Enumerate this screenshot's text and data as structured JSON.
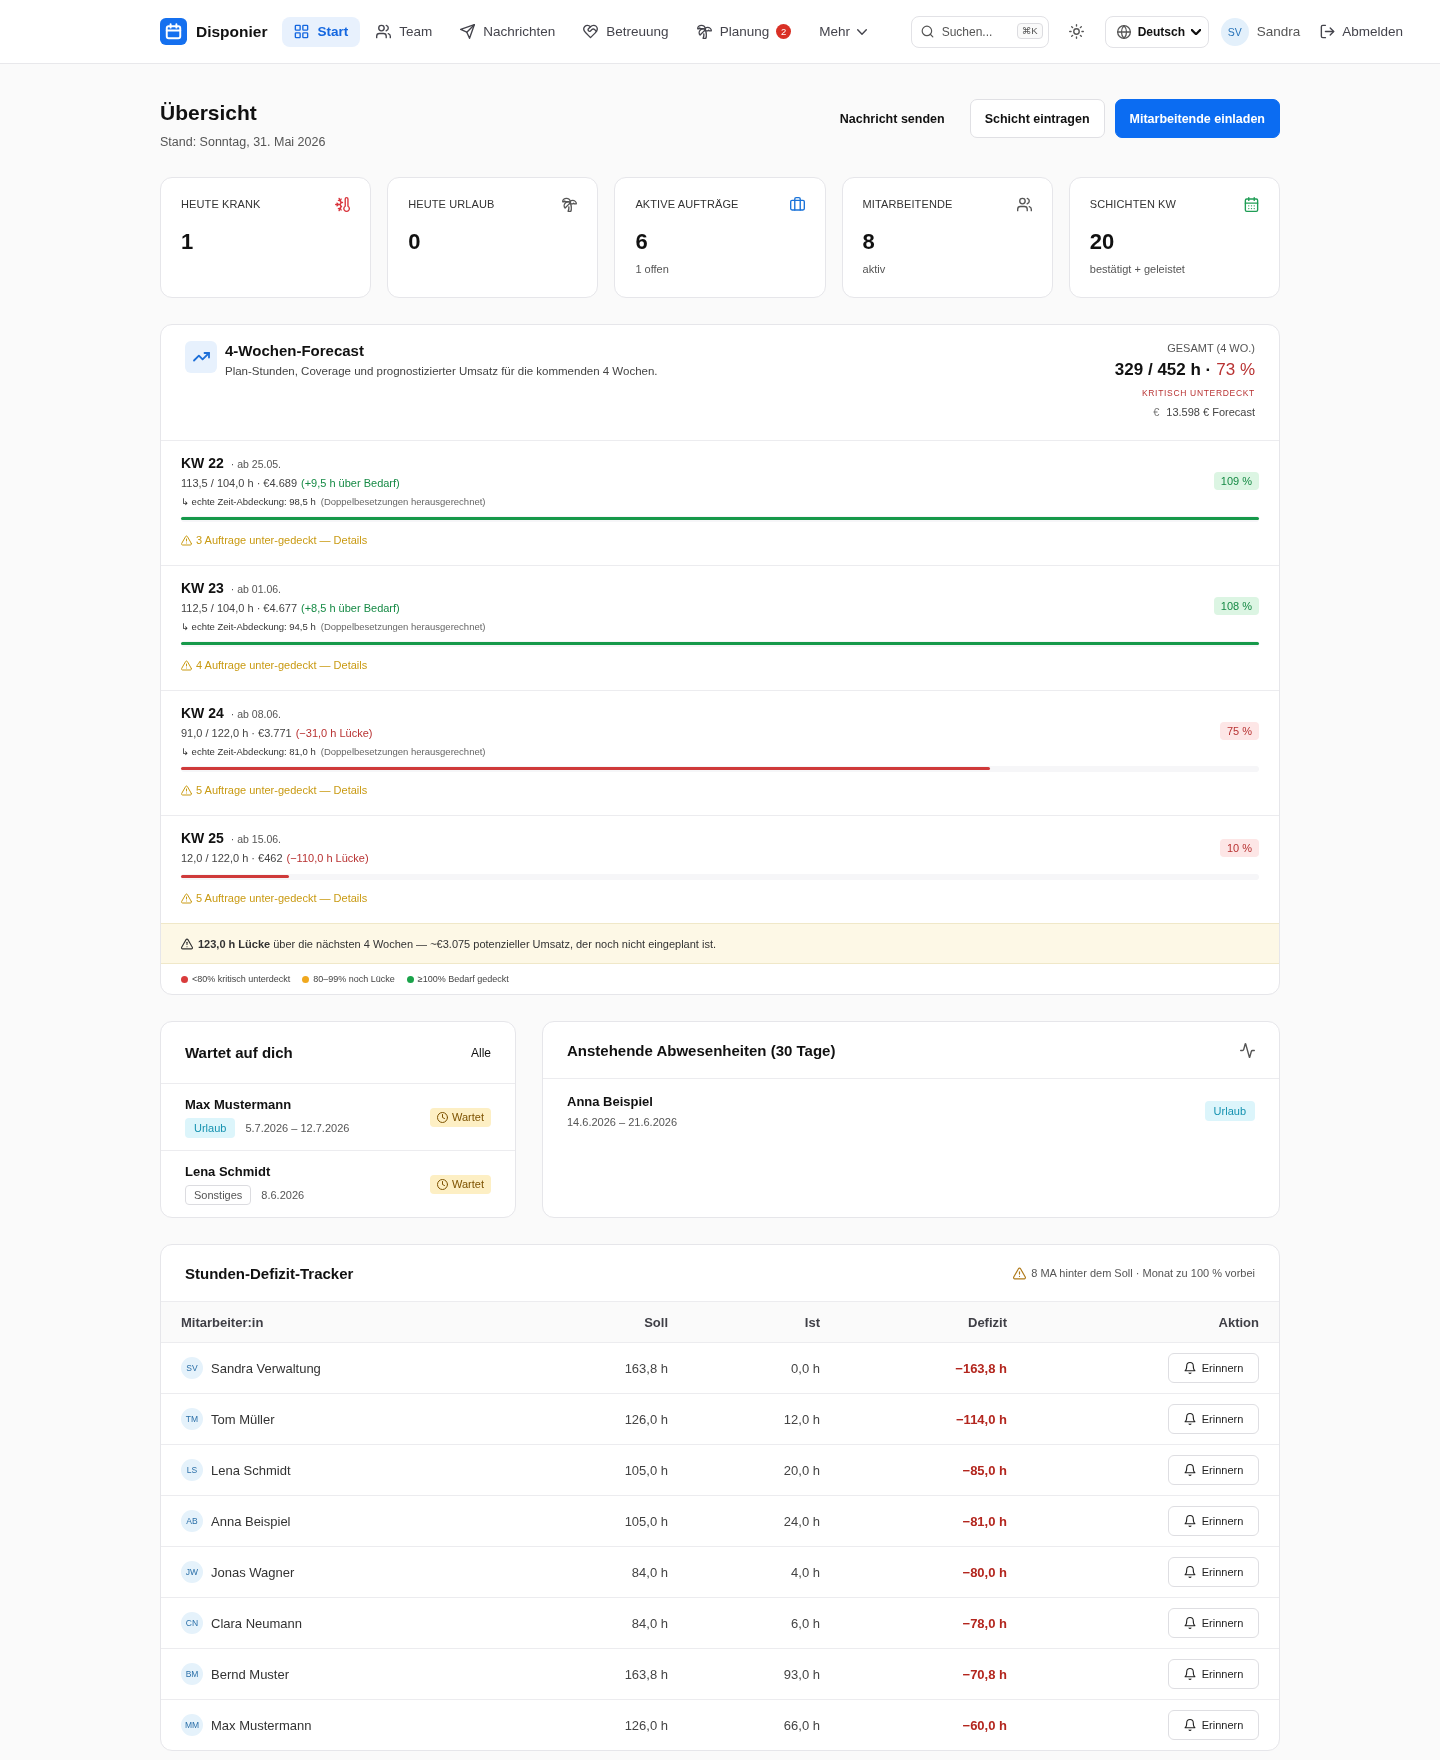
{
  "header": {
    "logo": "Disponier",
    "nav": [
      {
        "label": "Start",
        "selected": true
      },
      {
        "label": "Team",
        "selected": false
      },
      {
        "label": "Nachrichten",
        "selected": false
      },
      {
        "label": "Betreuung",
        "selected": false
      },
      {
        "label": "Planung",
        "selected": false,
        "badge": "2"
      },
      {
        "label": "Mehr",
        "selected": false
      }
    ],
    "search": {
      "placeholder": "Suchen...",
      "shortcut": "⌘K"
    },
    "language": "Deutsch",
    "user": {
      "initials": "SV",
      "name": "Sandra"
    },
    "logout": "Abmelden"
  },
  "page": {
    "title": "Übersicht",
    "subtitle": "Stand: Sonntag, 31. Mai 2026",
    "actions": [
      {
        "label": "Nachricht senden",
        "kind": "ghost"
      },
      {
        "label": "Schicht eintragen",
        "kind": "outline"
      },
      {
        "label": "Mitarbeitende einladen",
        "kind": "primary"
      }
    ]
  },
  "kpis": [
    {
      "label": "HEUTE KRANK",
      "value": "1",
      "color": "#d9363e"
    },
    {
      "label": "HEUTE URLAUB",
      "value": "0",
      "color": "#555555"
    },
    {
      "label": "AKTIVE AUFTRÄGE",
      "value": "6",
      "note": "1 offen",
      "color": "#1a73d9"
    },
    {
      "label": "MITARBEITENDE",
      "value": "8",
      "note": "aktiv",
      "color": "#555555"
    },
    {
      "label": "SCHICHTEN KW",
      "value": "20",
      "note": "bestätigt + geleistet",
      "color": "#1f9d55"
    }
  ],
  "forecast": {
    "title": "4-Wochen-Forecast",
    "description": "Plan-Stunden, Coverage und prognostizierter Umsatz für die kommenden 4 Wochen.",
    "total": {
      "label": "GESAMT (4 WO.)",
      "hours": "329 / 452 h ·",
      "percent": "73 %",
      "kind": "critical",
      "status_label": "KRITISCH UNTERDECKT",
      "currency": "€",
      "revenue": "13.598 € Forecast"
    },
    "weeks": [
      {
        "week": "KW 22",
        "start": "· ab 25.05.",
        "hours": "113,5 / 104,0 h · €4.689",
        "delta": "(+9,5 h über Bedarf)",
        "coverage": "↳ echte Zeit-Abdeckung: 98,5 h",
        "coverage_note": "(Doppelbesetzungen herausgerechnet)",
        "kind": "covered",
        "level": 1,
        "percent": "109 %",
        "warning": "3 Auftrage unter-gedeckt — Details"
      },
      {
        "week": "KW 23",
        "start": "· ab 01.06.",
        "hours": "112,5 / 104,0 h · €4.677",
        "delta": "(+8,5 h über Bedarf)",
        "coverage": "↳ echte Zeit-Abdeckung: 94,5 h",
        "coverage_note": "(Doppelbesetzungen herausgerechnet)",
        "kind": "covered",
        "level": 1,
        "percent": "108 %",
        "warning": "4 Auftrage unter-gedeckt — Details"
      },
      {
        "week": "KW 24",
        "start": "· ab 08.06.",
        "hours": "91,0 / 122,0 h · €3.771",
        "delta": "(−31,0 h Lücke)",
        "coverage": "↳ echte Zeit-Abdeckung: 81,0 h",
        "coverage_note": "(Doppelbesetzungen herausgerechnet)",
        "kind": "critical",
        "level": 0.75,
        "percent": "75 %",
        "warning": "5 Auftrage unter-gedeckt — Details"
      },
      {
        "week": "KW 25",
        "start": "· ab 15.06.",
        "hours": "12,0 / 122,0 h · €462",
        "delta": "(−110,0 h Lücke)",
        "kind": "critical",
        "level": 0.1,
        "percent": "10 %",
        "warning": "5 Auftrage unter-gedeckt — Details"
      }
    ],
    "summary": "**123,0 h Lücke** über die nächsten 4 Wochen — ~€3.075 potenzieller Umsatz, der noch nicht eingeplant ist.",
    "legend": [
      {
        "label": "<80% kritisch unterdeckt",
        "color": "#d93b3b"
      },
      {
        "label": "80–99% noch Lücke",
        "color": "#f0a81e"
      },
      {
        "label": "≥100% Bedarf gedeckt",
        "color": "#1aa34a"
      }
    ]
  },
  "waiting": {
    "title": "Wartet auf dich",
    "link": "Alle",
    "items": [
      {
        "name": "Max Mustermann",
        "kind": "vacation",
        "tag": "Urlaub",
        "dates": "5.7.2026 – 12.7.2026",
        "status": "Wartet"
      },
      {
        "name": "Lena Schmidt",
        "kind": "other",
        "tag": "Sonstiges",
        "dates": "8.6.2026",
        "status": "Wartet"
      }
    ]
  },
  "absences": {
    "title": "Anstehende Abwesenheiten (30 Tage)",
    "items": [
      {
        "name": "Anna Beispiel",
        "dates": "14.6.2026 – 21.6.2026",
        "kind": "vacation",
        "tag": "Urlaub"
      }
    ]
  },
  "deficit": {
    "title": "Stunden-Defizit-Tracker",
    "note": "8 MA hinter dem Soll · Monat zu 100 % vorbei",
    "columns": [
      "Mitarbeiter:in",
      "Soll",
      "Ist",
      "Defizit",
      "Aktion"
    ],
    "rows": [
      {
        "initials": "SV",
        "name": "Sandra Verwaltung",
        "target": "163,8 h",
        "actual": "0,0 h",
        "deficit": "−163,8 h",
        "action": "Erinnern"
      },
      {
        "initials": "TM",
        "name": "Tom Müller",
        "target": "126,0 h",
        "actual": "12,0 h",
        "deficit": "−114,0 h",
        "action": "Erinnern"
      },
      {
        "initials": "LS",
        "name": "Lena Schmidt",
        "target": "105,0 h",
        "actual": "20,0 h",
        "deficit": "−85,0 h",
        "action": "Erinnern"
      },
      {
        "initials": "AB",
        "name": "Anna Beispiel",
        "target": "105,0 h",
        "actual": "24,0 h",
        "deficit": "−81,0 h",
        "action": "Erinnern"
      },
      {
        "initials": "JW",
        "name": "Jonas Wagner",
        "target": "84,0 h",
        "actual": "4,0 h",
        "deficit": "−80,0 h",
        "action": "Erinnern"
      },
      {
        "initials": "CN",
        "name": "Clara Neumann",
        "target": "84,0 h",
        "actual": "6,0 h",
        "deficit": "−78,0 h",
        "action": "Erinnern"
      },
      {
        "initials": "BM",
        "name": "Bernd Muster",
        "target": "163,8 h",
        "actual": "93,0 h",
        "deficit": "−70,8 h",
        "action": "Erinnern"
      },
      {
        "initials": "MM",
        "name": "Max Mustermann",
        "target": "126,0 h",
        "actual": "66,0 h",
        "deficit": "−60,0 h",
        "action": "Erinnern"
      }
    ]
  }
}
